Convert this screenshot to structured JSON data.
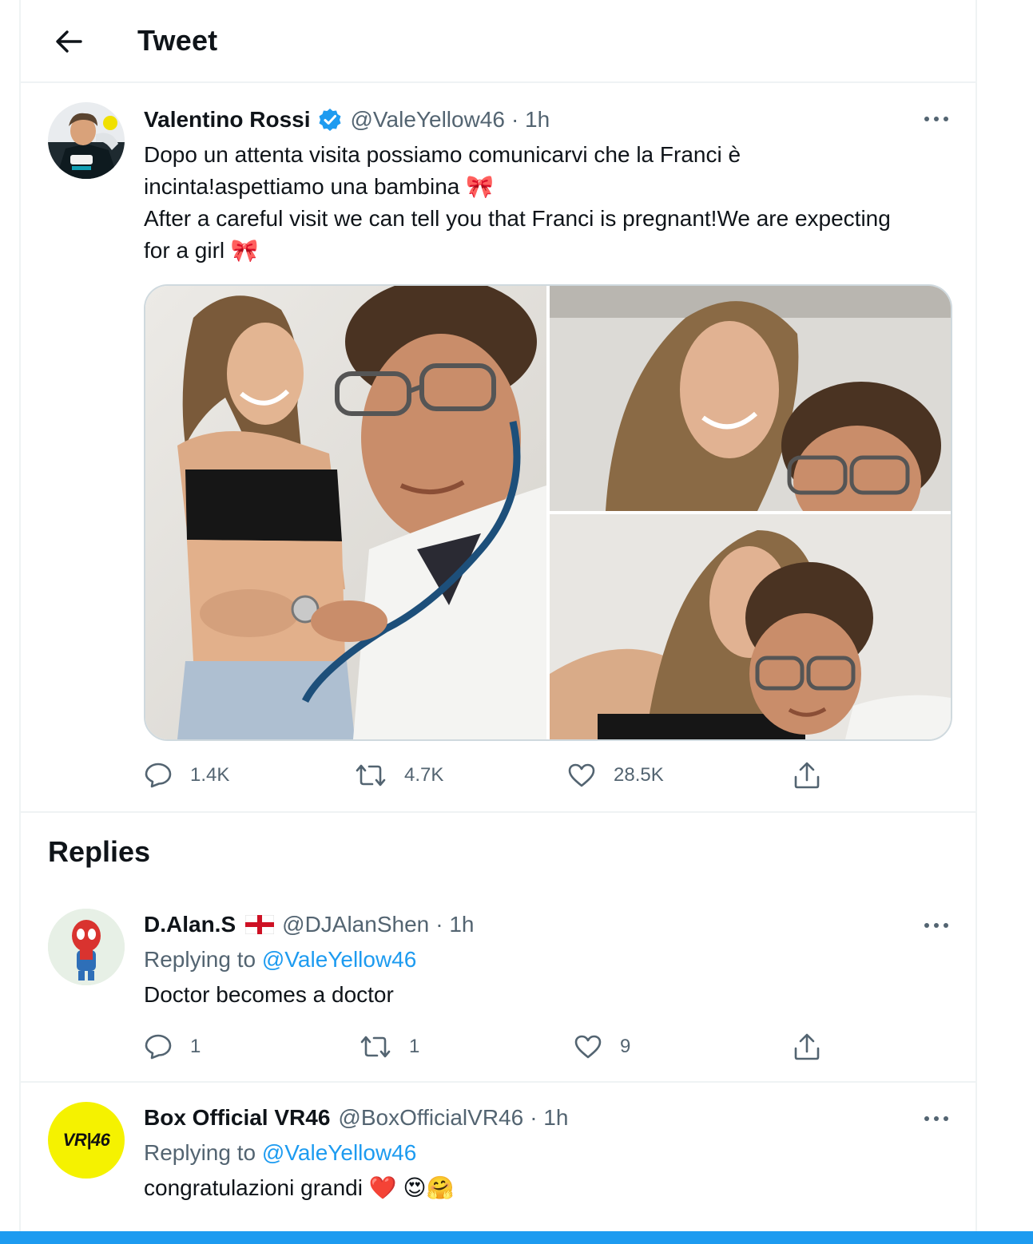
{
  "header": {
    "title": "Tweet",
    "back_icon": "arrow-left-icon"
  },
  "tweet": {
    "author_name": "Valentino Rossi",
    "verified": true,
    "handle": "@ValeYellow46",
    "time": "· 1h",
    "text_lines": [
      "Dopo un attenta visita possiamo comunicarvi che la Franci è",
      "incinta!aspettiamo una bambina 🎀",
      "After a careful visit we can tell you that Franci is pregnant!We are expecting",
      "for a girl 🎀"
    ],
    "photos": [
      "photo-stethoscope",
      "photo-selfie-top",
      "photo-selfie-bottom"
    ],
    "stats": {
      "replies": "1.4K",
      "retweets": "4.7K",
      "likes": "28.5K"
    }
  },
  "replies_section": {
    "title": "Replies"
  },
  "replies": [
    {
      "author_name": "D.Alan.S",
      "flag": "england-flag",
      "handle": "@DJAlanShen",
      "time": "· 1h",
      "replying_prefix": "Replying to",
      "replying_handle": "@ValeYellow46",
      "text": "Doctor becomes a doctor",
      "stats": {
        "replies": "1",
        "retweets": "1",
        "likes": "9"
      }
    },
    {
      "author_name": "Box Official VR46",
      "handle": "@BoxOfficialVR46",
      "time": "· 1h",
      "replying_prefix": "Replying to",
      "replying_handle": "@ValeYellow46",
      "text": "congratulazioni grandi ❤️ 😍🤗",
      "avatar_text": "VR|46"
    }
  ],
  "colors": {
    "accent": "#1d9bf0",
    "text": "#0f1419",
    "secondary": "#536471",
    "border": "#eff3f4",
    "vr46_yellow": "#f5f200"
  }
}
